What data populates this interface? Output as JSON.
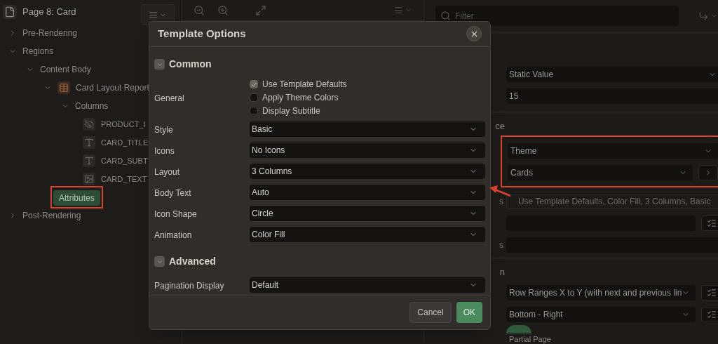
{
  "left_panel": {
    "page_title": "Page 8: Card",
    "tree": [
      {
        "kind": "folder",
        "label": "Pre-Rendering",
        "expanded": false
      },
      {
        "kind": "folder",
        "label": "Regions",
        "expanded": true,
        "children": [
          {
            "kind": "folder",
            "label": "Content Body",
            "expanded": true,
            "children": [
              {
                "kind": "region",
                "label": "Card Layout Report",
                "expanded": true,
                "children": [
                  {
                    "kind": "folder",
                    "label": "Columns",
                    "expanded": true,
                    "children": [
                      {
                        "kind": "hidden_column",
                        "label": "PRODUCT_I"
                      },
                      {
                        "kind": "text_column",
                        "label": "CARD_TITLE"
                      },
                      {
                        "kind": "text_column",
                        "label": "CARD_SUBT"
                      },
                      {
                        "kind": "image_column",
                        "label": "CARD_TEXT"
                      }
                    ]
                  },
                  {
                    "kind": "button",
                    "label": "Attributes",
                    "selected": true
                  }
                ]
              }
            ]
          }
        ]
      },
      {
        "kind": "folder",
        "label": "Post-Rendering",
        "expanded": false
      }
    ]
  },
  "right_panel": {
    "filter": {
      "placeholder": "Filter"
    },
    "sections": [
      {
        "rows": [
          {
            "kind": "select",
            "value": "Static Value"
          },
          {
            "kind": "input",
            "value": "15"
          }
        ]
      },
      {
        "heading": "ce",
        "rows": [
          {
            "kind": "select",
            "value": "Theme",
            "highlighted": true
          },
          {
            "kind": "select_button",
            "value": "Cards",
            "highlighted": true
          },
          {
            "kind": "display",
            "label": "s",
            "value": "Use Template Defaults, Color Fill, 3 Columns, Basic"
          },
          {
            "kind": "input_list"
          },
          {
            "kind": "input",
            "label": "s"
          }
        ]
      },
      {
        "heading": "n",
        "rows": [
          {
            "kind": "select_list",
            "value": "Row Ranges X to Y (with next and previous lin"
          },
          {
            "kind": "select_list",
            "value": "Bottom - Right"
          },
          {
            "kind": "switch",
            "label": "Partial Page",
            "on": true
          }
        ]
      }
    ]
  },
  "dialog": {
    "title": "Template Options",
    "sections": [
      {
        "title": "Common",
        "expanded": true,
        "rows": [
          {
            "kind": "checkboxes",
            "label": "General",
            "options": [
              {
                "label": "Use Template Defaults",
                "checked": true
              },
              {
                "label": "Apply Theme Colors",
                "checked": false
              },
              {
                "label": "Display Subtitle",
                "checked": false
              }
            ]
          },
          {
            "kind": "select",
            "label": "Style",
            "value": "Basic"
          },
          {
            "kind": "select",
            "label": "Icons",
            "value": "No Icons"
          },
          {
            "kind": "select",
            "label": "Layout",
            "value": "3 Columns"
          },
          {
            "kind": "select",
            "label": "Body Text",
            "value": "Auto"
          },
          {
            "kind": "select",
            "label": "Icon Shape",
            "value": "Circle"
          },
          {
            "kind": "select",
            "label": "Animation",
            "value": "Color Fill"
          }
        ]
      },
      {
        "title": "Advanced",
        "expanded": true,
        "rows": [
          {
            "kind": "select",
            "label": "Pagination Display",
            "value": "Default"
          }
        ]
      }
    ],
    "buttons": [
      {
        "kind": "secondary",
        "label": "Cancel"
      },
      {
        "kind": "primary",
        "label": "OK"
      }
    ]
  }
}
